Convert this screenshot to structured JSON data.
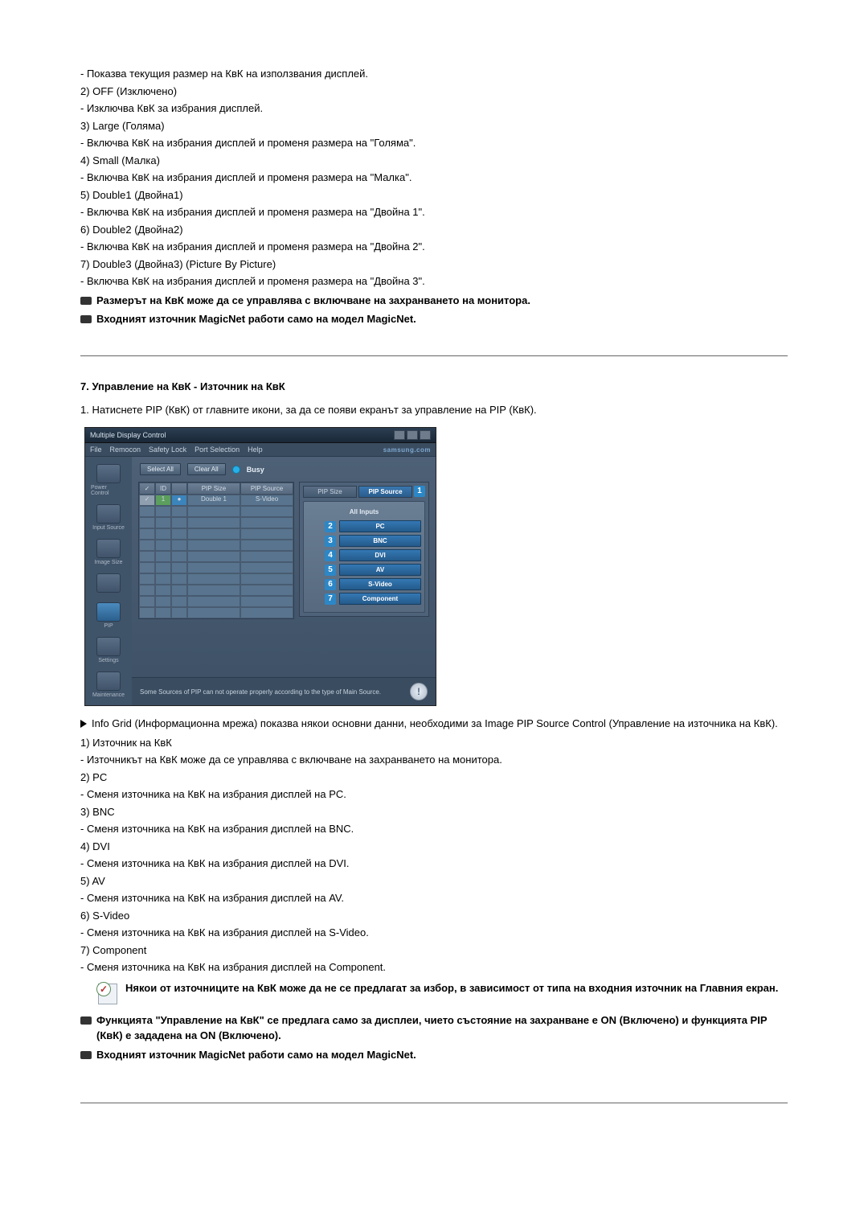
{
  "top": {
    "l1": "- Показва текущия размер на КвК на използвания дисплей.",
    "i2": "2)  OFF (Изключено)",
    "l2": "- Изключва КвК за избрания дисплей.",
    "i3": "3)  Large (Голяма)",
    "l3": "- Включва КвК на избрания дисплей и променя размера на \"Голяма\".",
    "i4": "4)  Small (Малка)",
    "l4": "- Включва КвК на избрания дисплей и променя размера на \"Малка\".",
    "i5": "5)  Double1 (Двойна1)",
    "l5": "- Включва КвК на избрания дисплей и променя размера на \"Двойна 1\".",
    "i6": "6)  Double2 (Двойна2)",
    "l6": "- Включва КвК на избрания дисплей и променя размера на \"Двойна 2\".",
    "i7": "7)  Double3 (Двойна3) (Picture By Picture)",
    "l7": "- Включва КвК на избрания дисплей и променя размера на \"Двойна 3\".",
    "note1": "Размерът на КвК може да се управлява с включване на захранването на монитора.",
    "note2": "Входният източник MagicNet работи само на модел MagicNet."
  },
  "section": {
    "title": "7. Управление на КвК - Източник на КвК",
    "intro": "1.  Натиснете PIP (КвК) от главните икони, за да се появи екранът за управление на PIP (КвК)."
  },
  "app": {
    "title": "Multiple Display Control",
    "menu": {
      "file": "File",
      "remocon": "Remocon",
      "safety": "Safety Lock",
      "port": "Port Selection",
      "help": "Help",
      "brand": "samsung.com"
    },
    "toolbar": {
      "select": "Select All",
      "clear": "Clear All",
      "busy": "Busy"
    },
    "grid": {
      "h_pip": "PIP Size",
      "h_src": "PIP Source",
      "r1a": "Double 1",
      "r1b": "S-Video"
    },
    "tabs": {
      "size": "PIP Size",
      "source": "PIP Source"
    },
    "callouts": {
      "c1": "1",
      "c2": "2",
      "c3": "3",
      "c4": "4",
      "c5": "5",
      "c6": "6",
      "c7": "7"
    },
    "src": {
      "title": "All Inputs",
      "pc": "PC",
      "bnc": "BNC",
      "dvi": "DVI",
      "av": "AV",
      "svideo": "S-Video",
      "comp": "Component"
    },
    "sidebar": {
      "power": "Power Control",
      "input": "Input Source",
      "image": "Image Size",
      "time": "",
      "pip": "PIP",
      "settings": "Settings",
      "maint": "Maintenance"
    },
    "status": "Some Sources of PIP can not operate properly according to the type of Main Source."
  },
  "below": {
    "arrow1": "Info Grid (Информационна мрежа) показва някои основни данни, необходими за Image PIP Source Control (Управление на източника на КвК).",
    "i1": "1)  Източник на КвК",
    "l1": "- Източникът на КвК може да се управлява с включване на захранването на монитора.",
    "i2": "2)  PC",
    "l2": "- Сменя източника на КвК на избрания дисплей на PC.",
    "i3": "3)  BNC",
    "l3": "- Сменя източника на КвК на избрания дисплей на BNC.",
    "i4": "4)  DVI",
    "l4": "- Сменя източника на КвК на избрания дисплей на DVI.",
    "i5": "5)  AV",
    "l5": "- Сменя източника на КвК на избрания дисплей на AV.",
    "i6": "6)  S-Video",
    "l6": "- Сменя източника на КвК на избрания дисплей на S-Video.",
    "i7": "7)  Component",
    "l7": "- Сменя източника на КвК на избрания дисплей на Component.",
    "warn": "Някои от източниците на КвК може да не се предлагат за избор, в зависимост от типа на входния източник на Главния екран.",
    "note1": "Функцията \"Управление на КвК\" се предлага само за дисплеи, чието състояние на захранване е ON (Включено) и функцията PIP (КвК) е зададена на ON (Включено).",
    "note2": "Входният източник MagicNet работи само на модел MagicNet."
  }
}
